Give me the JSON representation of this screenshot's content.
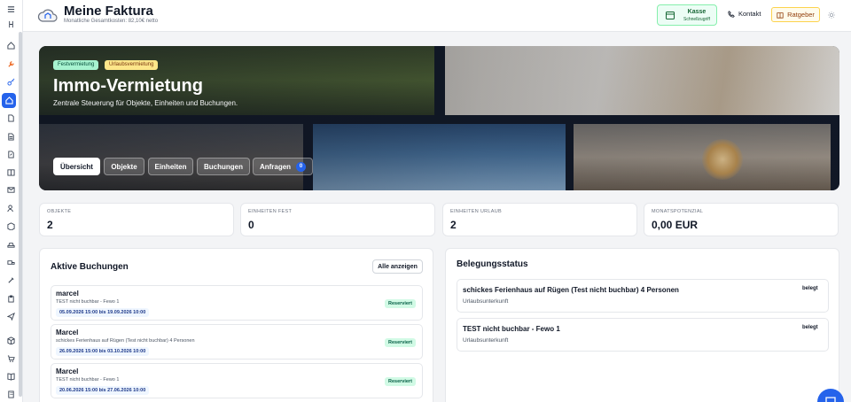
{
  "app": {
    "title": "Meine Faktura",
    "subtitle": "Monatliche Gesamtkosten: 82,10€ netto"
  },
  "header": {
    "kasse_label": "Kasse",
    "kasse_sub": "Schnellzugriff",
    "kontakt_label": "Kontakt",
    "ratgeber_label": "Ratgeber"
  },
  "sidebar": {
    "icons": [
      "menu-icon",
      "collapse-icon",
      "home-icon",
      "wrench-icon",
      "key-icon",
      "house-icon",
      "document-in-icon",
      "document-icon",
      "document-out-icon",
      "book-icon",
      "mail-icon",
      "users-icon",
      "box-icon",
      "car-icon",
      "truck-icon",
      "tools-icon",
      "clipboard-icon",
      "send-icon",
      "package-icon",
      "cart-icon",
      "book-open-icon",
      "building-icon"
    ],
    "active_index": 5
  },
  "hero": {
    "badges": [
      "Festvermietung",
      "Urlaubsvermietung"
    ],
    "title": "Immo-Vermietung",
    "subtitle": "Zentrale Steuerung für Objekte, Einheiten und Buchungen.",
    "tabs": [
      {
        "label": "Übersicht",
        "active": true
      },
      {
        "label": "Objekte",
        "active": false
      },
      {
        "label": "Einheiten",
        "active": false
      },
      {
        "label": "Buchungen",
        "active": false
      },
      {
        "label": "Anfragen",
        "active": false,
        "count": "0"
      }
    ]
  },
  "stats": [
    {
      "label": "OBJEKTE",
      "value": "2"
    },
    {
      "label": "EINHEITEN FEST",
      "value": "0"
    },
    {
      "label": "EINHEITEN URLAUB",
      "value": "2"
    },
    {
      "label": "MONATSPOTENZIAL",
      "value": "0,00 EUR"
    }
  ],
  "bookings": {
    "title": "Aktive Buchungen",
    "all_label": "Alle anzeigen",
    "items": [
      {
        "name": "marcel",
        "unit": "TEST nicht buchbar - Fewo 1",
        "dates": "05.09.2026 15:00 bis 19.09.2026 10:00",
        "status": "Reserviert"
      },
      {
        "name": "Marcel",
        "unit": "schickes Ferienhaus auf Rügen (Test nicht buchbar) 4 Personen",
        "dates": "26.09.2026 15:00 bis 03.10.2026 10:00",
        "status": "Reserviert"
      },
      {
        "name": "Marcel",
        "unit": "TEST nicht buchbar - Fewo 1",
        "dates": "20.06.2026 15:00 bis 27.06.2026 10:00",
        "status": "Reserviert"
      }
    ]
  },
  "occupancy": {
    "title": "Belegungsstatus",
    "items": [
      {
        "name": "schickes Ferienhaus auf Rügen (Test nicht buchbar) 4 Personen",
        "type": "Urlaubsunterkunft",
        "status": "belegt"
      },
      {
        "name": "TEST nicht buchbar - Fewo 1",
        "type": "Urlaubsunterkunft",
        "status": "belegt"
      }
    ]
  },
  "colors": {
    "accent": "#2563eb",
    "kasse_border": "#86efac",
    "ratgeber_border": "#fcd34d",
    "status_reserved": "#d1fae5"
  }
}
